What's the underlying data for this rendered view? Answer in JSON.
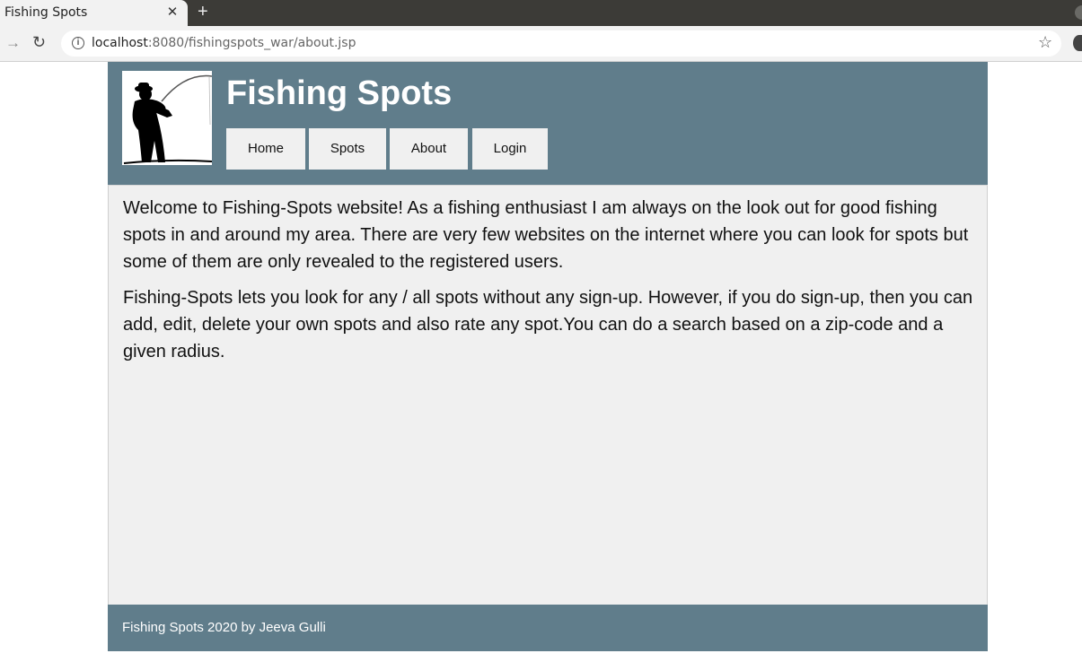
{
  "browser": {
    "tab_title": "Fishing Spots",
    "tab_close": "✕",
    "new_tab": "+",
    "url_host": "localhost",
    "url_rest": ":8080/fishingspots_war/about.jsp",
    "info_icon": "i",
    "back_icon": "→",
    "reload_icon": "↻",
    "star_icon": "☆"
  },
  "header": {
    "title": "Fishing Spots",
    "logo_icon": "fisherman-silhouette"
  },
  "nav": {
    "home": "Home",
    "spots": "Spots",
    "about": "About",
    "login": "Login"
  },
  "content": {
    "paragraph1": "Welcome to Fishing-Spots website! As a fishing enthusiast I am always on the look out for good fishing spots in and around my area. There are very few websites on the internet where you can look for spots but some of them are only revealed to the registered users.",
    "paragraph2": "Fishing-Spots lets you look for any / all spots without any sign-up. However, if you do sign-up, then you can add, edit, delete your own spots and also rate any spot.You can do a search based on a zip-code and a given radius."
  },
  "footer": {
    "text": "Fishing Spots 2020 by Jeeva Gulli"
  },
  "colors": {
    "header_bg": "#607d8b",
    "content_bg": "#f0f0f0",
    "button_bg": "#f0f0f0"
  }
}
